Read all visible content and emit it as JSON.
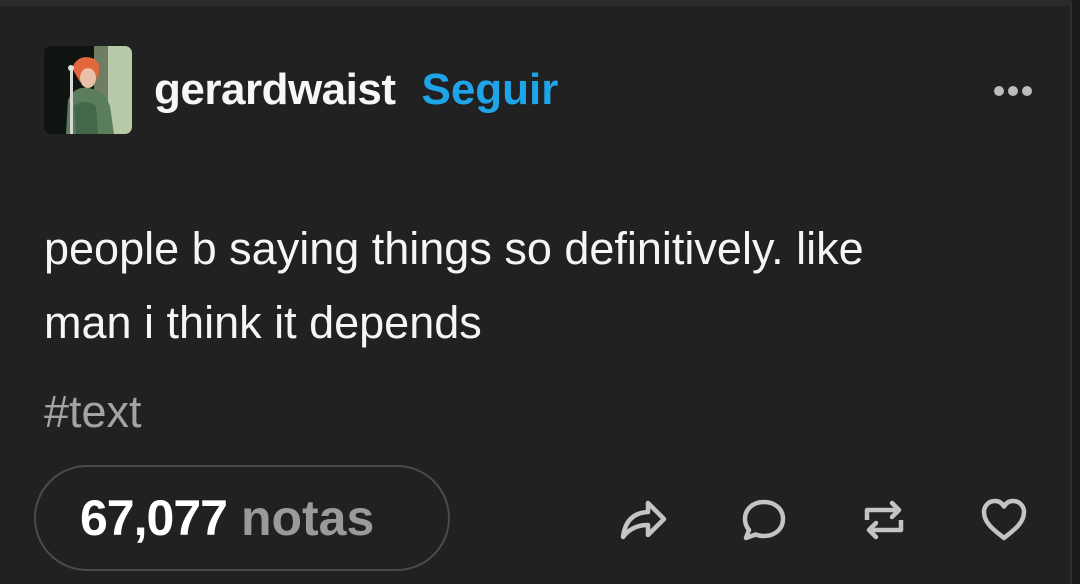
{
  "post": {
    "blog_name": "gerardwaist",
    "follow_label": "Seguir",
    "body_lines": [
      "people b saying things so definitively. like",
      "man i think it depends"
    ],
    "tags": [
      "#text"
    ],
    "notes_count": "67,077",
    "notes_label": "notas"
  },
  "icons": {
    "more": "more-horizontal-icon",
    "share": "share-icon",
    "reply": "reply-icon",
    "reblog": "reblog-icon",
    "like": "heart-icon"
  },
  "colors": {
    "background": "#212121",
    "accent": "#1ea5e9",
    "text": "#f5f5f5",
    "muted": "#9a9a9a",
    "icon": "#c4c4c4"
  }
}
